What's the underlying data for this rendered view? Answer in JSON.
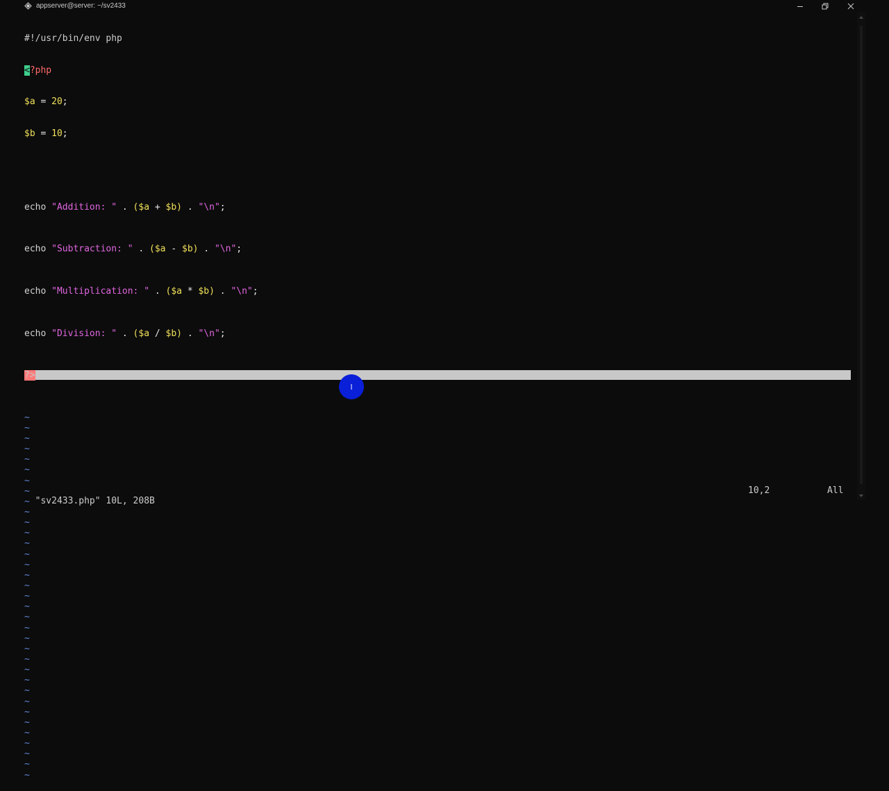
{
  "window": {
    "title": "appserver@server: ~/sv2433",
    "icon": "putty-terminal-icon",
    "controls": [
      "minimize-icon",
      "restore-icon",
      "close-icon"
    ]
  },
  "editor": {
    "shebang": "#!/usr/bin/env php",
    "open_tag_cursor": "<",
    "open_tag_rest": "?php",
    "assign_a": {
      "var": "$a",
      "eq": " = ",
      "num": "20",
      "end": ";"
    },
    "assign_b": {
      "var": "$b",
      "eq": " = ",
      "num": "10",
      "end": ";"
    },
    "echo_kw": "echo",
    "lines": [
      {
        "str": "\"Addition: \"",
        "dot1": " . ",
        "lp": "(",
        "a": "$a",
        "op": " + ",
        "b": "$b",
        "rp": ")",
        "dot2": " . ",
        "nl": "\"\\n\"",
        "semi": ";"
      },
      {
        "str": "\"Subtraction: \"",
        "dot1": " . ",
        "lp": "(",
        "a": "$a",
        "op": " - ",
        "b": "$b",
        "rp": ")",
        "dot2": " . ",
        "nl": "\"\\n\"",
        "semi": ";"
      },
      {
        "str": "\"Multiplication: \"",
        "dot1": " . ",
        "lp": "(",
        "a": "$a",
        "op": " * ",
        "b": "$b",
        "rp": ")",
        "dot2": " . ",
        "nl": "\"\\n\"",
        "semi": ";"
      },
      {
        "str": "\"Division: \"",
        "dot1": " . ",
        "lp": "(",
        "a": "$a",
        "op": " / ",
        "b": "$b",
        "rp": ")",
        "dot2": " . ",
        "nl": "\"\\n\"",
        "semi": ";"
      }
    ],
    "close_tag": "?>",
    "empty_marker": "~"
  },
  "status": {
    "file_info": "\"sv2433.php\" 10L, 208B",
    "cursor_position": "10,2",
    "scroll_position": "All"
  },
  "mouse_cursor_glyph": "I",
  "colors": {
    "background": "#0c0c0c",
    "tilde": "#5f87d7",
    "variable": "#f0e05a",
    "string": "#e066e0",
    "tag": "#ff6a6a",
    "cursor": "#3ecf8e",
    "line_highlight": "#c8c8c8",
    "mouse_highlight": "#0a1fd8"
  }
}
